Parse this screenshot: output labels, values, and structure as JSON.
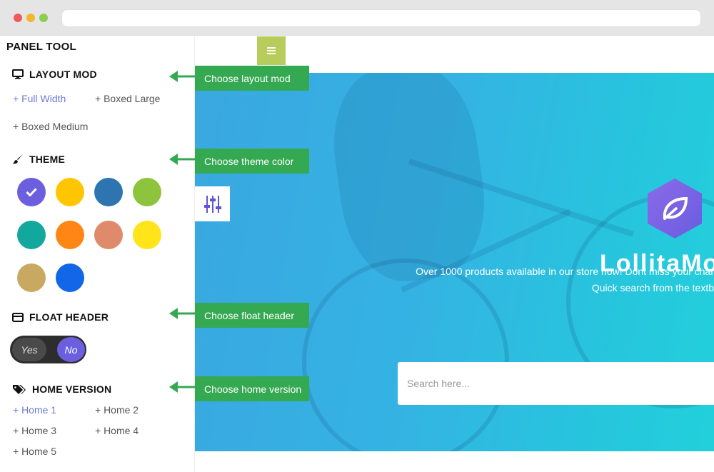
{
  "panel": {
    "title": "PANEL TOOL",
    "layout": {
      "title": "LAYOUT MOD",
      "options": [
        "+ Full Width",
        "+ Boxed Large",
        "+ Boxed Medium"
      ]
    },
    "theme": {
      "title": "THEME",
      "colors": [
        "#6b5fe0",
        "#ffc600",
        "#2d74b0",
        "#8dc43e",
        "#12a89d",
        "#ff8514",
        "#e08a6c",
        "#ffe41a",
        "#c9a962",
        "#1167e8"
      ]
    },
    "float_header": {
      "title": "FLOAT HEADER",
      "yes_label": "Yes",
      "no_label": "No"
    },
    "home_version": {
      "title": "HOME VERSION",
      "options": [
        "+ Home 1",
        "+ Home 2",
        "+ Home 3",
        "+ Home 4",
        "+ Home 5"
      ]
    }
  },
  "callouts": {
    "layout": "Choose layout mod",
    "theme": "Choose theme color",
    "float": "Choose float header",
    "home": "Choose home version"
  },
  "hero": {
    "brand": "LollitaMo",
    "tagline_1": "Over 1000 products available in our store now! Dont miss your char",
    "tagline_2": "Quick search from the textb",
    "search_placeholder": "Search here..."
  },
  "colors": {
    "accent": "#6d7bd8",
    "callout_green": "#35a852",
    "menu_button": "#b6cc5b",
    "logo_purple": "#7a63e6"
  }
}
